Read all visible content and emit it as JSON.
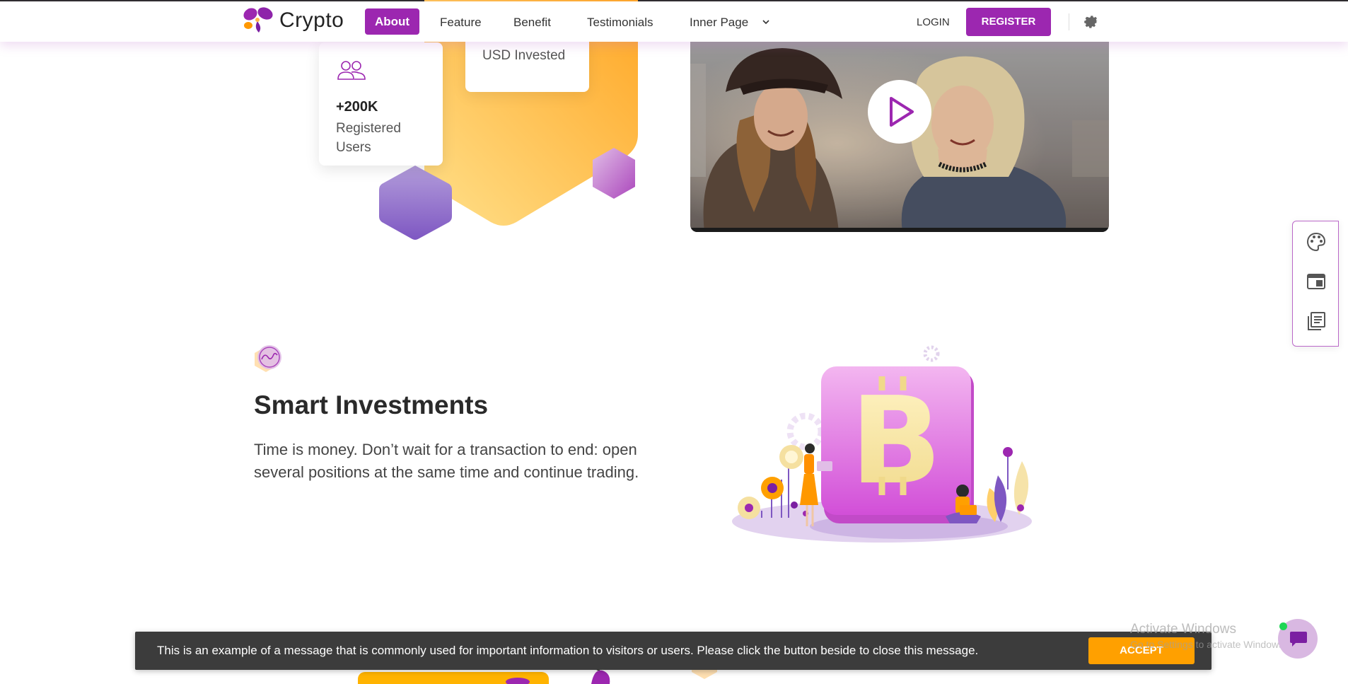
{
  "colors": {
    "accent": "#9c27b0",
    "accent_light": "#ba68c8",
    "orange": "#ffa000",
    "cookie_bg": "#3c3c3c"
  },
  "header": {
    "brand": "Crypto",
    "logo_icon": "crypto-logo",
    "nav": {
      "about": "About",
      "feature": "Feature",
      "benefit": "Benefit",
      "testimonials": "Testimonials",
      "inner_page": "Inner Page"
    },
    "login": "LOGIN",
    "register": "REGISTER",
    "settings_icon": "gear-icon"
  },
  "stats": {
    "invested_label": "USD Invested",
    "users_value": "+200K",
    "users_label": "Registered Users",
    "users_icon": "users-icon"
  },
  "video": {
    "play_icon": "play-icon"
  },
  "side_panel": {
    "icons": [
      "palette-icon",
      "layout-icon",
      "pages-icon"
    ]
  },
  "feature": {
    "icon": "chart-hexagon-icon",
    "title": "Smart Investments",
    "description": "Time is money. Don’t wait for a transaction to end: open several positions at the same time and continue trading."
  },
  "cookie": {
    "message": "This is an example of a message that is commonly used for important information to visitors or users. Please click the button beside to close this message.",
    "accept": "ACCEPT"
  },
  "watermark": {
    "line1": "Activate Windows",
    "line2": "Go to Settings to activate Windows."
  },
  "chat": {
    "icon": "chat-icon"
  }
}
